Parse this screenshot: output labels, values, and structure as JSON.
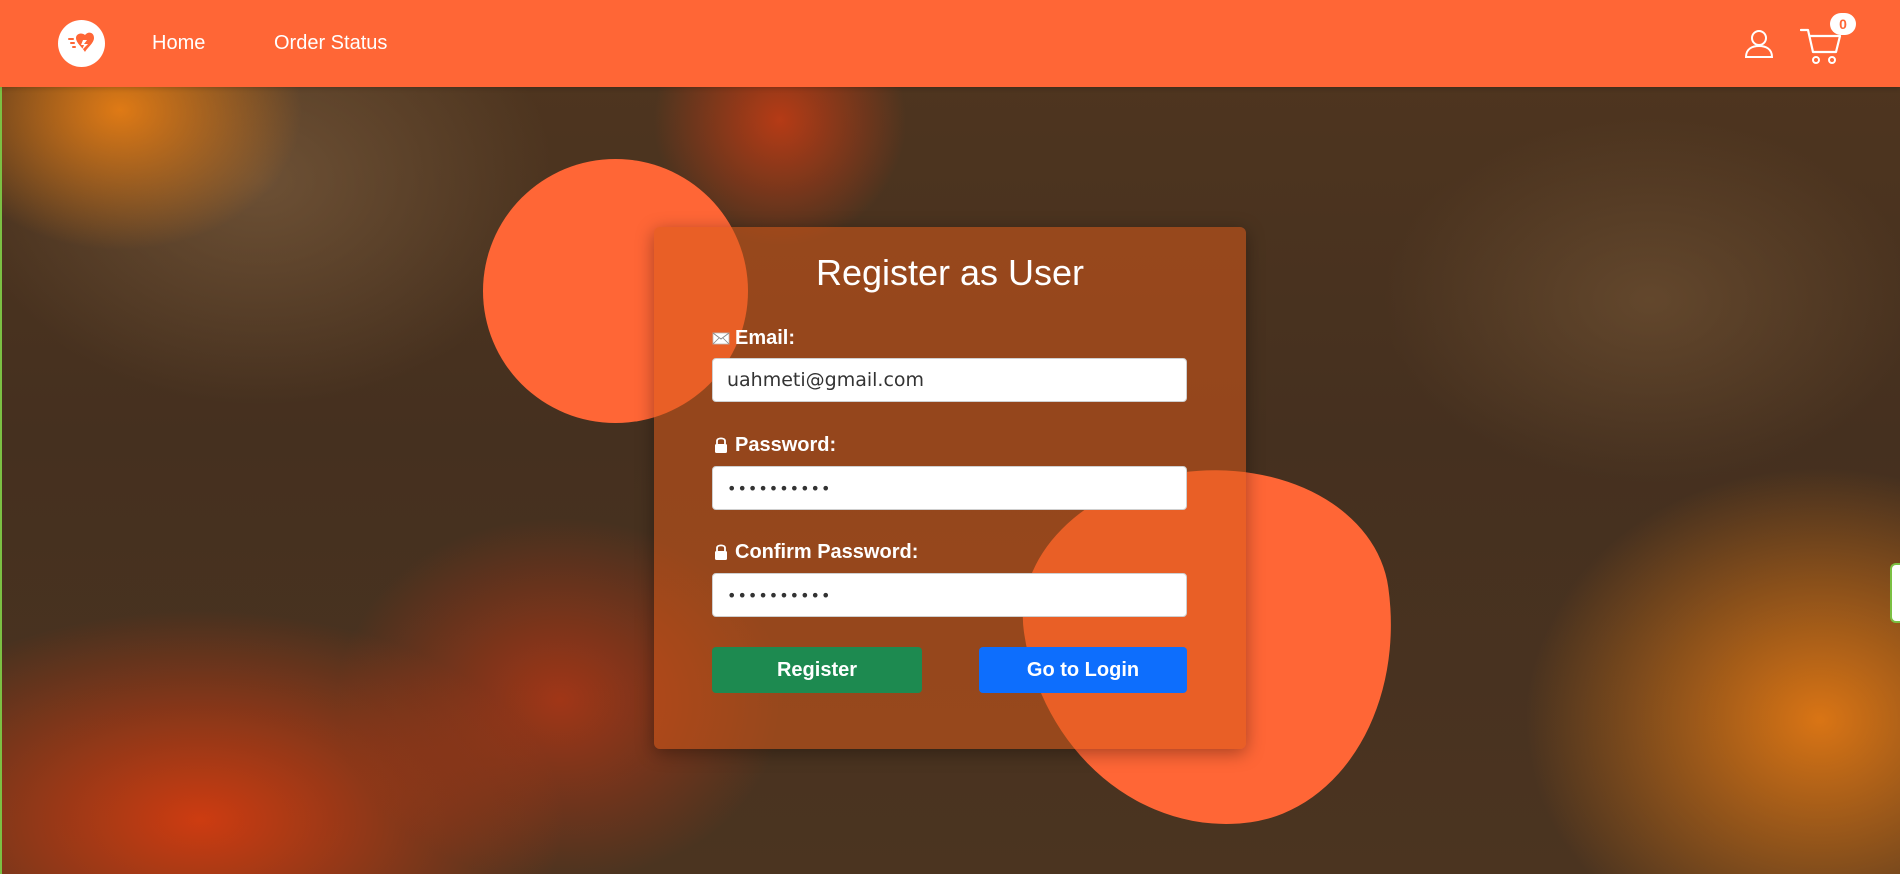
{
  "navbar": {
    "logo_icon": "delivery-heart-logo-icon",
    "links": [
      "Home",
      "Order Status"
    ],
    "user_icon": "user-icon",
    "cart_icon": "cart-icon",
    "cart_count": "0",
    "color": "#ff6636"
  },
  "register": {
    "title": "Register as User",
    "email_label": "Email:",
    "email_value": "uahmeti@gmail.com",
    "password_label": "Password:",
    "password_value": "••••••••••",
    "confirm_label": "Confirm Password:",
    "confirm_value": "••••••••••",
    "register_button": "Register",
    "login_button": "Go to Login",
    "register_color": "#1d8a50",
    "login_color": "#0d6efd"
  }
}
